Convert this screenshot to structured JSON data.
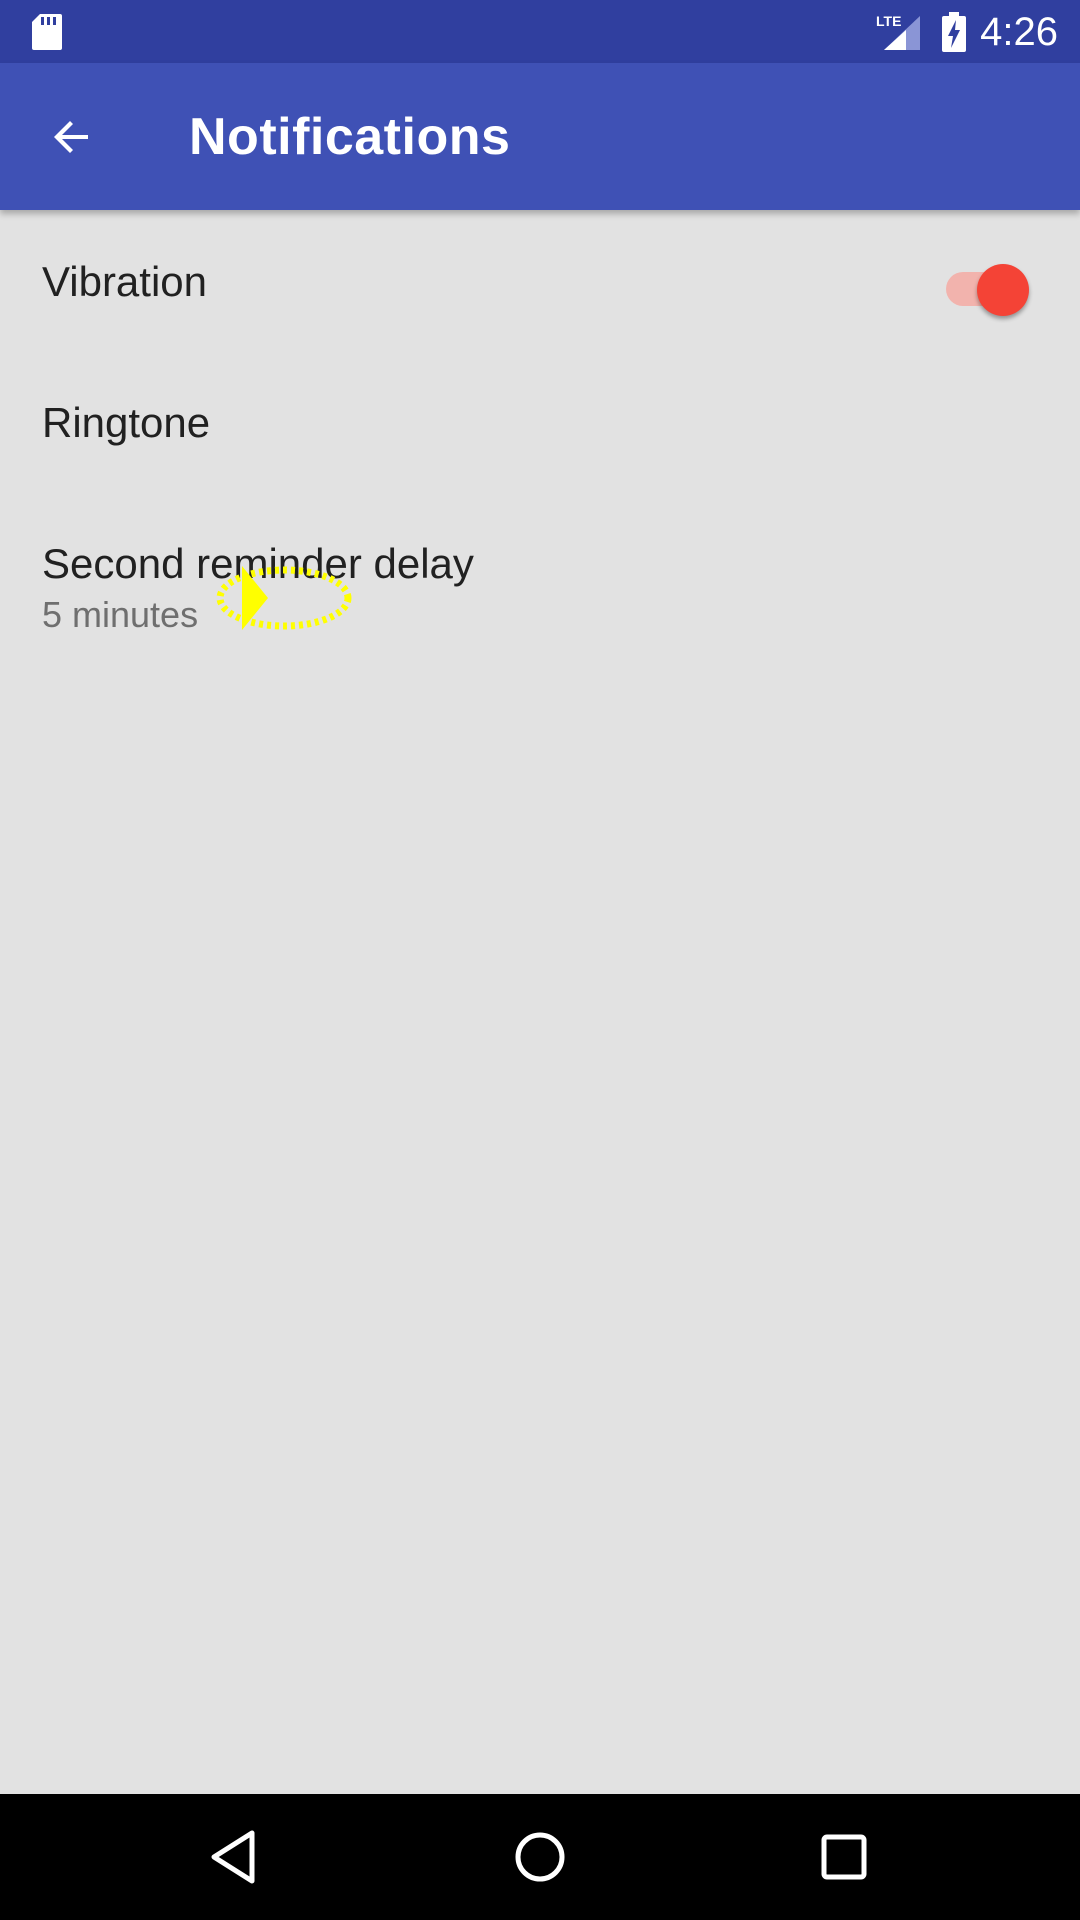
{
  "status_bar": {
    "time": "4:26",
    "icons": [
      "sd-card-icon",
      "lte-signal-icon",
      "battery-charging-icon"
    ],
    "network_label": "LTE"
  },
  "app_bar": {
    "title": "Notifications",
    "back_icon": "arrow-back-icon"
  },
  "settings": {
    "items": [
      {
        "title": "Vibration",
        "type": "switch",
        "checked": true
      },
      {
        "title": "Ringtone",
        "type": "preference"
      },
      {
        "title": "Second reminder delay",
        "summary": "5 minutes",
        "type": "list-preference"
      }
    ]
  },
  "navigation_bar": {
    "buttons": [
      "nav-back-icon",
      "nav-home-icon",
      "nav-recents-icon"
    ]
  },
  "colors": {
    "status_bar": "#303f9f",
    "app_bar": "#3f51b5",
    "background": "#e2e2e2",
    "accent": "#f44336",
    "switch_track": "#f2b3ad",
    "touch_indicator": "#ffff00"
  }
}
